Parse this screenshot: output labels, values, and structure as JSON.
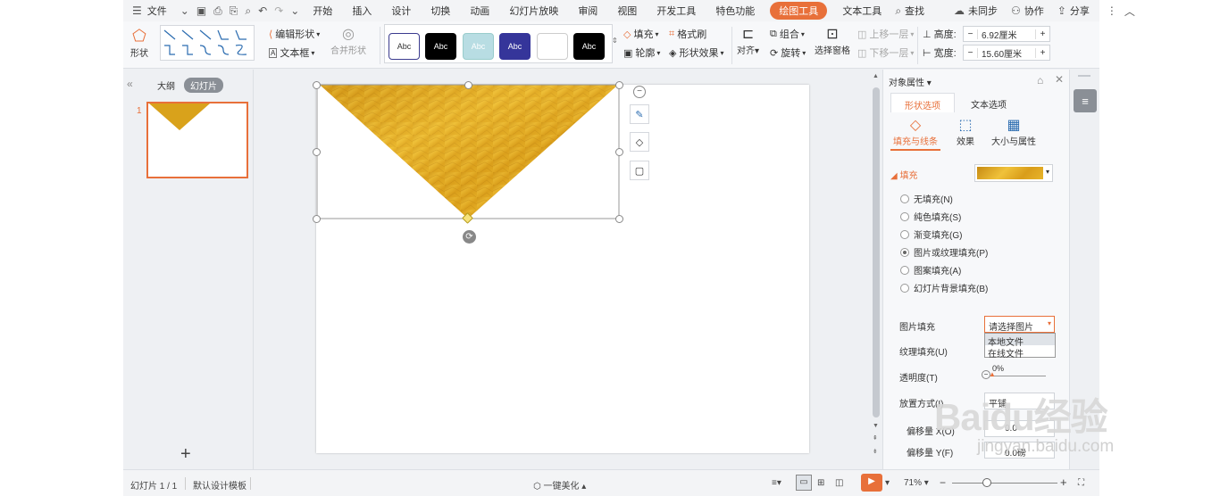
{
  "menubar": {
    "file": "文件",
    "tabs": [
      "开始",
      "插入",
      "设计",
      "切换",
      "动画",
      "幻灯片放映",
      "审阅",
      "视图",
      "开发工具",
      "特色功能",
      "绘图工具",
      "文本工具"
    ],
    "active_tab": "绘图工具",
    "search": "查找",
    "sync": "未同步",
    "collab": "协作",
    "share": "分享"
  },
  "ribbon": {
    "shape": "形状",
    "edit_shape": "编辑形状",
    "textbox": "文本框",
    "merge_shape": "合并形状",
    "styles": [
      "Abc",
      "Abc",
      "Abc",
      "Abc",
      "",
      "Abc"
    ],
    "fill": "填充",
    "outline": "轮廓",
    "format_brush": "格式刷",
    "shape_effect": "形状效果",
    "align": "对齐",
    "group": "组合",
    "rotate": "旋转",
    "selection_pane": "选择窗格",
    "bring_forward": "上移一层",
    "send_backward": "下移一层",
    "height_label": "高度:",
    "height_value": "6.92厘米",
    "width_label": "宽度:",
    "width_value": "15.60厘米"
  },
  "left_panel": {
    "tab_outline": "大纲",
    "tab_slides": "幻灯片",
    "slide_number": "1",
    "add": "+"
  },
  "props": {
    "title": "对象属性",
    "tab_shape": "形状选项",
    "tab_text": "文本选项",
    "sub_fill_line": "填充与线条",
    "sub_effect": "效果",
    "sub_size": "大小与属性",
    "fill_section": "填充",
    "options": [
      "无填充(N)",
      "纯色填充(S)",
      "渐变填充(G)",
      "图片或纹理填充(P)",
      "图案填充(A)",
      "幻灯片背景填充(B)"
    ],
    "selected_option": 3,
    "picture_fill_label": "图片填充",
    "picture_fill_value": "请选择图片",
    "dropdown_items": [
      "本地文件",
      "在线文件"
    ],
    "texture_label": "纹理填充(U)",
    "transparency_label": "透明度(T)",
    "transparency_value": "0%",
    "placement_label": "放置方式(I)",
    "placement_value": "平铺",
    "offset_x_label": "偏移量 X(O)",
    "offset_x_value": "0.0",
    "offset_y_label": "偏移量 Y(F)",
    "offset_y_value": "0.0磅"
  },
  "status": {
    "slide_count": "幻灯片 1 / 1",
    "template": "默认设计模板",
    "beautify": "一键美化",
    "zoom": "71%"
  },
  "watermark": {
    "text": "Baidu经验",
    "url": "jingyan.baidu.com"
  },
  "colors": {
    "accent": "#e8703a",
    "gold": "#d9a21b"
  }
}
